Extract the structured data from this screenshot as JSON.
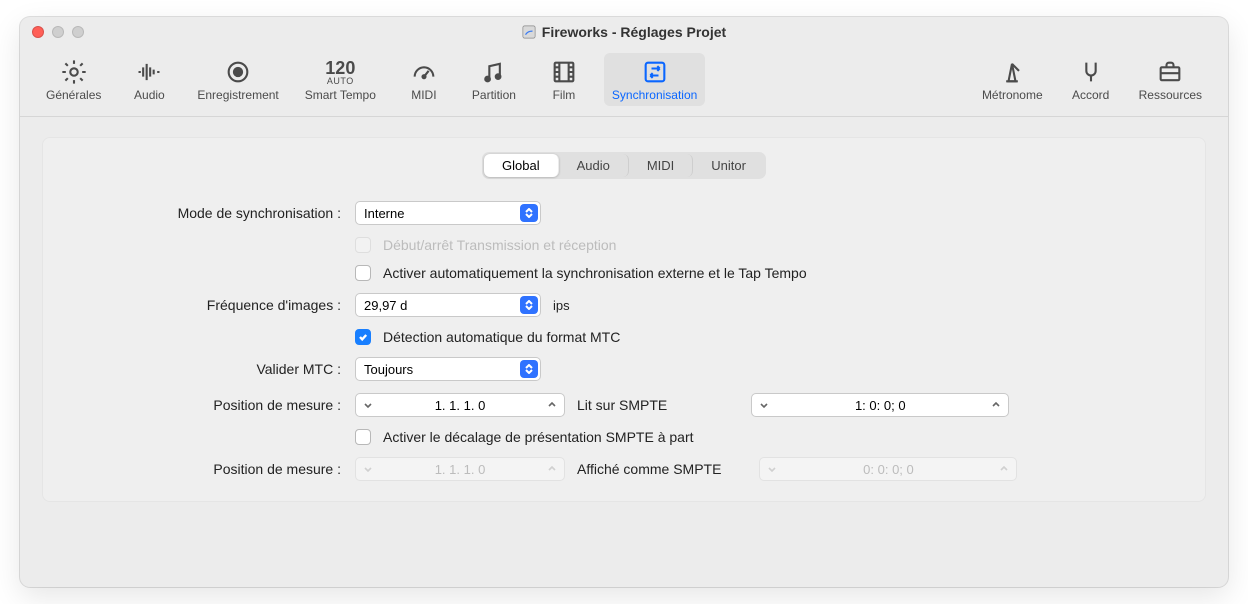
{
  "window": {
    "title": "Fireworks - Réglages Projet"
  },
  "toolbar": {
    "items": [
      {
        "label": "Générales"
      },
      {
        "label": "Audio"
      },
      {
        "label": "Enregistrement"
      },
      {
        "label": "Smart Tempo"
      },
      {
        "label": "MIDI"
      },
      {
        "label": "Partition"
      },
      {
        "label": "Film"
      },
      {
        "label": "Synchronisation"
      },
      {
        "label": "Métronome"
      },
      {
        "label": "Accord"
      },
      {
        "label": "Ressources"
      }
    ],
    "tempo": {
      "big": "120",
      "small": "AUTO"
    }
  },
  "subtabs": {
    "items": [
      {
        "label": "Global"
      },
      {
        "label": "Audio"
      },
      {
        "label": "MIDI"
      },
      {
        "label": "Unitor"
      }
    ]
  },
  "form": {
    "syncModeLabel": "Mode de synchronisation :",
    "syncModeValue": "Interne",
    "transmitRecvLabel": "Début/arrêt Transmission et réception",
    "autoExternalLabel": "Activer automatiquement la synchronisation externe et le Tap Tempo",
    "frameRateLabel": "Fréquence d'images :",
    "frameRateValue": "29,97 d",
    "frameRateUnit": "ips",
    "autoMtcLabel": "Détection automatique du format MTC",
    "validateMtcLabel": "Valider MTC :",
    "validateMtcValue": "Toujours",
    "barPosLabel": "Position de mesure :",
    "barPosValue1": "1. 1. 1.    0",
    "readsAtSmpte": "Lit sur SMPTE",
    "smpteValue1": "1: 0: 0; 0",
    "enableOffsetLabel": "Activer le décalage de présentation SMPTE à part",
    "barPosLabel2": "Position de mesure :",
    "barPosValue2": "1. 1. 1.    0",
    "displayedAsSmpte": "Affiché comme SMPTE",
    "smpteValue2": "0: 0: 0; 0"
  }
}
